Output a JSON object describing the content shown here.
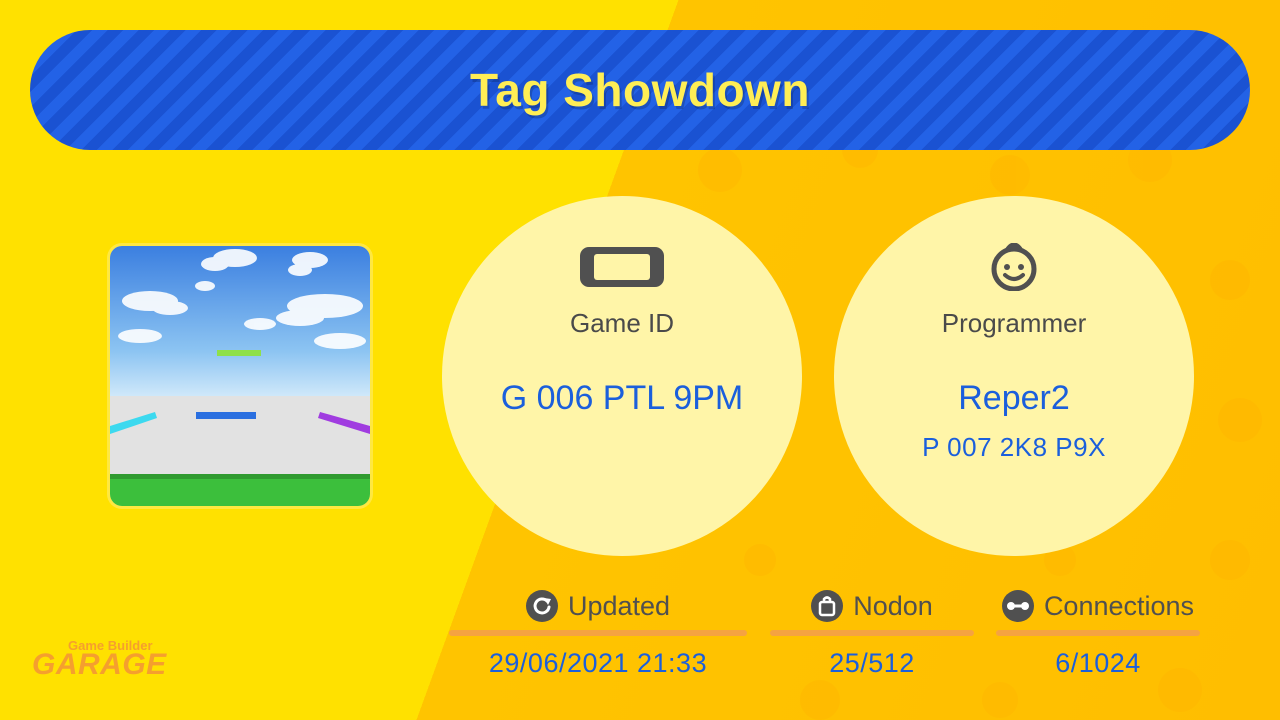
{
  "title": "Tag Showdown",
  "game_id": {
    "icon": "switch-console-icon",
    "label": "Game ID",
    "value": "G 006 PTL 9PM"
  },
  "programmer": {
    "icon": "face-icon",
    "label": "Programmer",
    "name": "Reper2",
    "id": "P 007 2K8 P9X"
  },
  "stats": {
    "updated": {
      "icon": "refresh-icon",
      "label": "Updated",
      "value": "29/06/2021 21:33"
    },
    "nodon": {
      "icon": "bag-icon",
      "label": "Nodon",
      "value": "25/512"
    },
    "connections": {
      "icon": "connection-icon",
      "label": "Connections",
      "value": "6/1024"
    }
  },
  "brand": {
    "top": "Game Builder",
    "main": "GARAGE"
  },
  "colors": {
    "background": "#ffe100",
    "title_bar": "#2362e6",
    "title_text": "#ffee55",
    "circle": "#fff5a8",
    "value_text": "#1b5fdc",
    "rule": "#f5a341",
    "brand": "#f59f2e"
  }
}
